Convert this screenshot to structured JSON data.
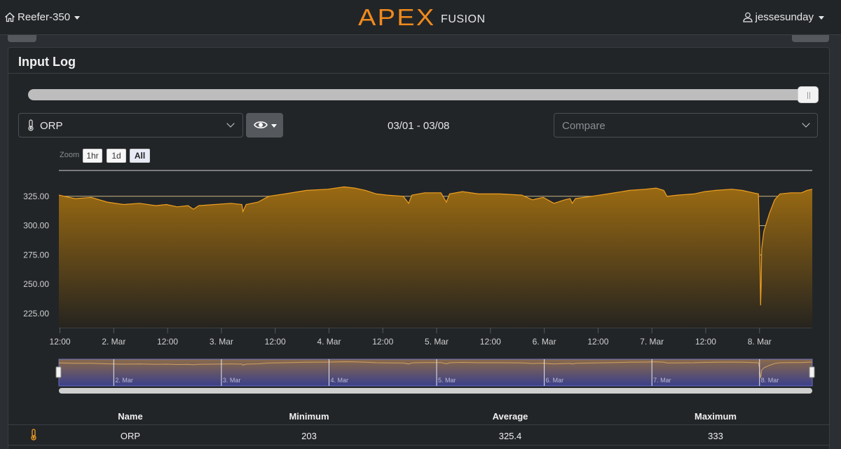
{
  "nav": {
    "device": "Reefer-350",
    "user": "jessesunday",
    "logo_main": "APEX",
    "logo_sub": "FUSION"
  },
  "panel": {
    "title": "Input Log"
  },
  "slider": {
    "position": 1.0
  },
  "controls": {
    "input_selected": "ORP",
    "date_range": "03/01 - 03/08",
    "compare_placeholder": "Compare"
  },
  "zoom": {
    "label": "Zoom",
    "options": [
      "1hr",
      "1d",
      "All"
    ],
    "active": "All"
  },
  "chart_data": {
    "type": "area",
    "series": [
      {
        "name": "ORP"
      }
    ],
    "yticks": [
      "225.00",
      "250.00",
      "275.00",
      "300.00",
      "325.00"
    ],
    "ylim": [
      213,
      347
    ],
    "xticks": [
      "12:00",
      "2. Mar",
      "12:00",
      "3. Mar",
      "12:00",
      "4. Mar",
      "12:00",
      "5. Mar",
      "12:00",
      "6. Mar",
      "12:00",
      "7. Mar",
      "12:00",
      "8. Mar"
    ],
    "xlim": [
      0,
      7
    ],
    "navigator_labels": [
      "2. Mar",
      "3. Mar",
      "4. Mar",
      "5. Mar",
      "6. Mar",
      "7. Mar",
      "8. Mar"
    ],
    "colors": {
      "line": "#f0a020",
      "fill_top": "#9a6a12",
      "fill_bottom": "#26241f",
      "grid": "#e6d090"
    },
    "points": [
      [
        0.0,
        326
      ],
      [
        0.15,
        323
      ],
      [
        0.3,
        324
      ],
      [
        0.45,
        320
      ],
      [
        0.6,
        318
      ],
      [
        0.75,
        319
      ],
      [
        0.9,
        317
      ],
      [
        1.0,
        318
      ],
      [
        1.1,
        316
      ],
      [
        1.2,
        317
      ],
      [
        1.25,
        314
      ],
      [
        1.3,
        317
      ],
      [
        1.45,
        318
      ],
      [
        1.6,
        319
      ],
      [
        1.7,
        318
      ],
      [
        1.71,
        312
      ],
      [
        1.74,
        318
      ],
      [
        1.85,
        320
      ],
      [
        1.95,
        325
      ],
      [
        2.1,
        327
      ],
      [
        2.3,
        330
      ],
      [
        2.5,
        331
      ],
      [
        2.65,
        333
      ],
      [
        2.75,
        332
      ],
      [
        2.85,
        330
      ],
      [
        2.95,
        327
      ],
      [
        3.05,
        326
      ],
      [
        3.2,
        325
      ],
      [
        3.25,
        319
      ],
      [
        3.28,
        326
      ],
      [
        3.4,
        328
      ],
      [
        3.55,
        328
      ],
      [
        3.6,
        320
      ],
      [
        3.63,
        327
      ],
      [
        3.75,
        329
      ],
      [
        3.9,
        327
      ],
      [
        4.1,
        327
      ],
      [
        4.3,
        326
      ],
      [
        4.4,
        322
      ],
      [
        4.5,
        324
      ],
      [
        4.6,
        319
      ],
      [
        4.7,
        322
      ],
      [
        4.75,
        323
      ],
      [
        4.77,
        319
      ],
      [
        4.8,
        323
      ],
      [
        4.95,
        325
      ],
      [
        5.1,
        327
      ],
      [
        5.3,
        330
      ],
      [
        5.45,
        331
      ],
      [
        5.55,
        332
      ],
      [
        5.62,
        330
      ],
      [
        5.65,
        325
      ],
      [
        5.75,
        326
      ],
      [
        5.9,
        327
      ],
      [
        6.0,
        329
      ],
      [
        6.1,
        330
      ],
      [
        6.25,
        331
      ],
      [
        6.35,
        330
      ],
      [
        6.45,
        328
      ],
      [
        6.5,
        327
      ],
      [
        6.51,
        290
      ],
      [
        6.52,
        232
      ],
      [
        6.525,
        250
      ],
      [
        6.53,
        280
      ],
      [
        6.55,
        295
      ],
      [
        6.6,
        310
      ],
      [
        6.65,
        322
      ],
      [
        6.7,
        327
      ],
      [
        6.8,
        328
      ],
      [
        6.9,
        328
      ],
      [
        6.95,
        330
      ],
      [
        7.0,
        331
      ]
    ]
  },
  "stats": {
    "headers": [
      "Name",
      "Minimum",
      "Average",
      "Maximum"
    ],
    "rows": [
      {
        "name": "ORP",
        "min": "203",
        "avg": "325.4",
        "max": "333"
      }
    ]
  }
}
